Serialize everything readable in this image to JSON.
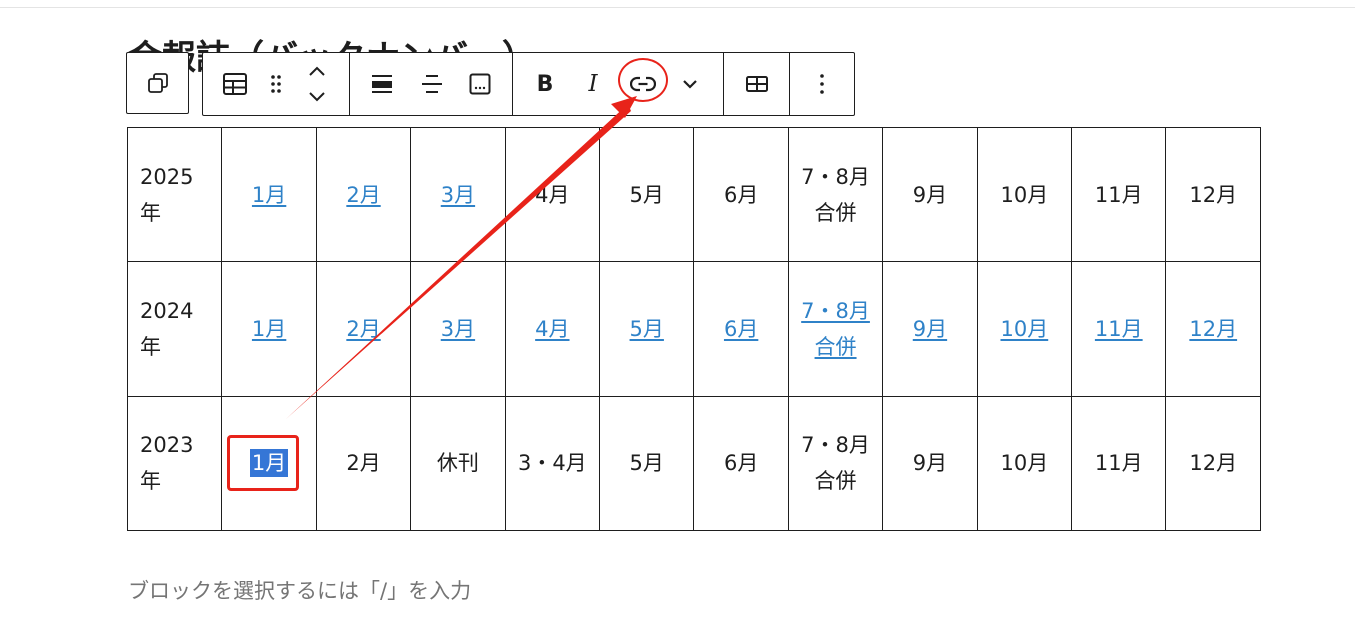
{
  "heading": "会報誌（バックナンバー）",
  "toolbar": {
    "transform_icon": "block-transform-icon",
    "table_icon": "table-icon",
    "drag_icon": "drag-handle-icon",
    "move_icon": "move-up-down-icon",
    "align_wide_icon": "align-wide-icon",
    "align_center_icon": "align-center-icon",
    "caption_icon": "caption-icon",
    "bold": "B",
    "italic": "I",
    "link_icon": "link-icon",
    "more_icon": "chevron-down-icon",
    "edit_table_icon": "edit-table-icon",
    "options_icon": "more-vertical-icon"
  },
  "table": {
    "rows": [
      {
        "year": "2025年",
        "cells": [
          {
            "text": "1月",
            "link": true
          },
          {
            "text": "2月",
            "link": true
          },
          {
            "text": "3月",
            "link": true
          },
          {
            "text": "4月",
            "link": false
          },
          {
            "text": "5月",
            "link": false
          },
          {
            "text": "6月",
            "link": false
          },
          {
            "text": "7・8月合併",
            "link": false
          },
          {
            "text": "9月",
            "link": false
          },
          {
            "text": "10月",
            "link": false
          },
          {
            "text": "11月",
            "link": false
          },
          {
            "text": "12月",
            "link": false
          }
        ]
      },
      {
        "year": "2024年",
        "cells": [
          {
            "text": "1月",
            "link": true
          },
          {
            "text": "2月",
            "link": true
          },
          {
            "text": "3月",
            "link": true
          },
          {
            "text": "4月",
            "link": true
          },
          {
            "text": "5月",
            "link": true
          },
          {
            "text": "6月",
            "link": true
          },
          {
            "text": "7・8月合併",
            "link": true
          },
          {
            "text": "9月",
            "link": true
          },
          {
            "text": "10月",
            "link": true
          },
          {
            "text": "11月",
            "link": true
          },
          {
            "text": "12月",
            "link": true
          }
        ]
      },
      {
        "year": "2023年",
        "cells": [
          {
            "text": "1月",
            "link": false,
            "selected": true
          },
          {
            "text": "2月",
            "link": false
          },
          {
            "text": "休刊",
            "link": false
          },
          {
            "text": "3・4月",
            "link": false
          },
          {
            "text": "5月",
            "link": false
          },
          {
            "text": "6月",
            "link": false
          },
          {
            "text": "7・8月合併",
            "link": false
          },
          {
            "text": "9月",
            "link": false
          },
          {
            "text": "10月",
            "link": false
          },
          {
            "text": "11月",
            "link": false
          },
          {
            "text": "12月",
            "link": false
          }
        ]
      }
    ]
  },
  "placeholder": "ブロックを選択するには「/」を入力",
  "colors": {
    "link": "#2f82c8",
    "selection": "#3576d6",
    "annotation": "#e8231a"
  }
}
